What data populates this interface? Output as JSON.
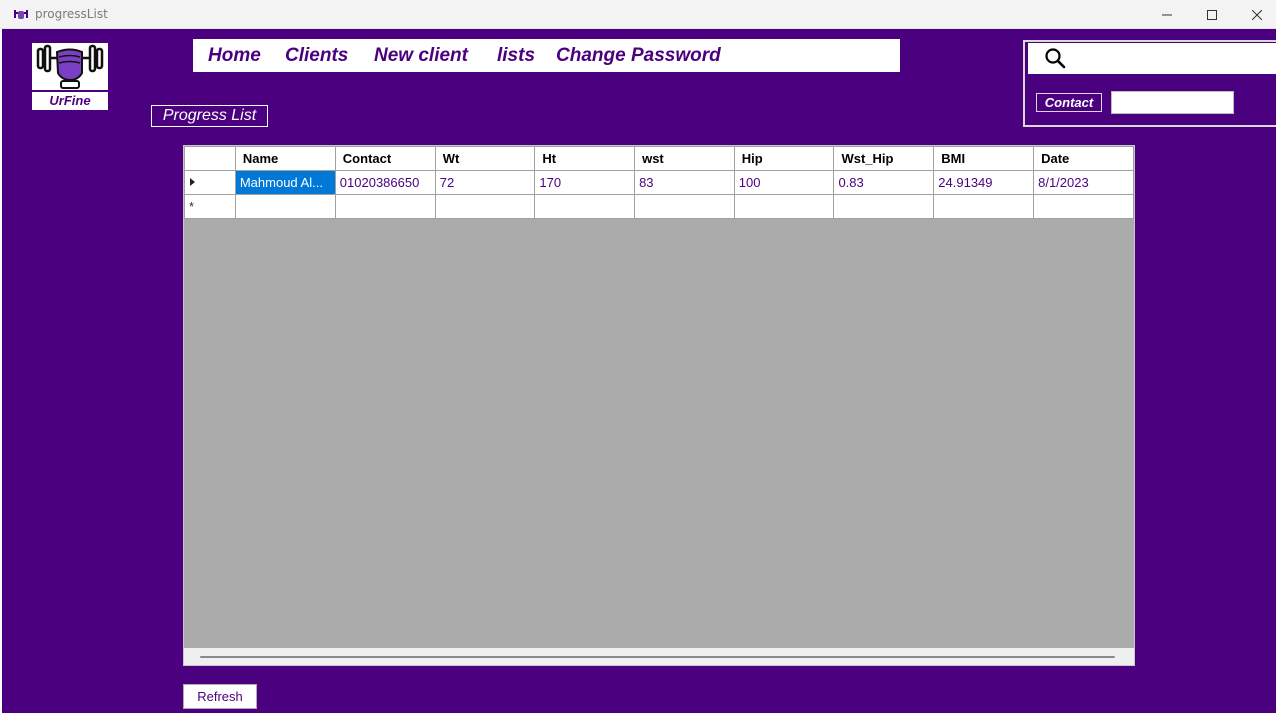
{
  "window": {
    "title": "progressList",
    "minimize_icon": "minimize-icon",
    "maximize_icon": "maximize-icon",
    "close_icon": "close-icon"
  },
  "logo": {
    "icon": "dumbbell-fist-icon",
    "caption": "UrFine"
  },
  "menu": {
    "items": [
      {
        "label": "Home"
      },
      {
        "label": "Clients"
      },
      {
        "label": "New client"
      },
      {
        "label": "lists"
      },
      {
        "label": "Change Password"
      }
    ]
  },
  "search": {
    "icon": "search-icon",
    "value": "",
    "contact_label": "Contact",
    "contact_value": ""
  },
  "page": {
    "title": "Progress List"
  },
  "grid": {
    "columns": [
      "Name",
      "Contact",
      "Wt",
      "Ht",
      "wst",
      "Hip",
      "Wst_Hip",
      "BMI",
      "Date"
    ],
    "rows": [
      [
        "Mahmoud Al...",
        "01020386650",
        "72",
        "170",
        "83",
        "100",
        "0.83",
        "24.91349",
        "8/1/2023"
      ]
    ],
    "new_row_marker": "*",
    "current_row_icon": "row-pointer-icon"
  },
  "buttons": {
    "refresh": "Refresh"
  },
  "colors": {
    "background": "#4b0080",
    "selection": "#0078d7",
    "grid_empty": "#ababab"
  }
}
